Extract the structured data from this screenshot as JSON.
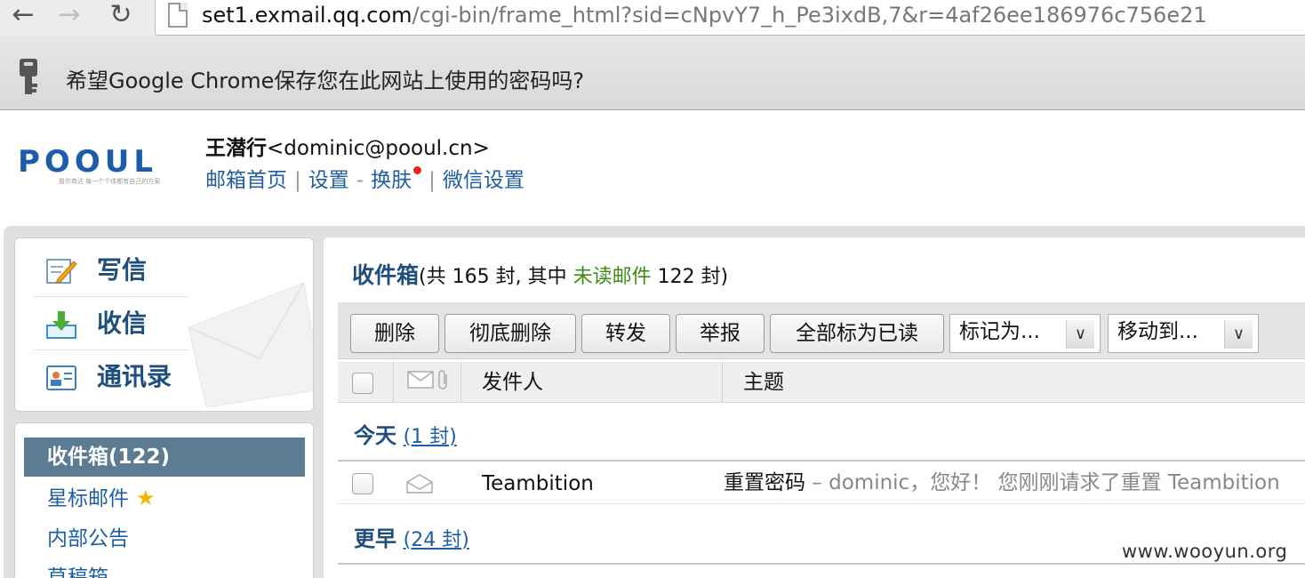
{
  "browser": {
    "url_host": "set1.exmail.qq.com",
    "url_path": "/cgi-bin/frame_html?sid=cNpvY7_h_Pe3ixdB,7&r=4af26ee186976c756e21",
    "password_prompt": "希望Google Chrome保存您在此网站上使用的密码吗?"
  },
  "header": {
    "logo_text": "POOUL",
    "logo_tagline": "普尔商达 每一个个体都有自己的方案",
    "user_name": "王潜行",
    "user_email": "<dominic@pooul.cn>",
    "links": {
      "home": "邮箱首页",
      "settings": "设置",
      "dash": "-",
      "skin": "换肤",
      "wechat": "微信设置",
      "pipe": "|"
    }
  },
  "quick_actions": {
    "compose": "写信",
    "receive": "收信",
    "contacts": "通讯录"
  },
  "folders": {
    "inbox": "收件箱(122)",
    "starred": "星标邮件",
    "announcements": "内部公告",
    "drafts": "草稿箱"
  },
  "mailbox": {
    "title": "收件箱",
    "summary_prefix": "(共 165 封, 其中 ",
    "unread_link": "未读邮件",
    "summary_suffix": " 122 封)"
  },
  "toolbar": {
    "delete": "删除",
    "delete_permanent": "彻底删除",
    "forward": "转发",
    "report": "举报",
    "mark_all_read": "全部标为已读",
    "mark_as": "标记为...",
    "move_to": "移动到..."
  },
  "columns": {
    "sender": "发件人",
    "subject": "主题"
  },
  "groups": {
    "today": {
      "name": "今天",
      "count": "(1 封)"
    },
    "earlier": {
      "name": "更早",
      "count": "(24 封)"
    }
  },
  "rows": [
    {
      "sender": "Teambition",
      "subject": "重置密码",
      "snippet": " – dominic，您好！ 您刚刚请求了重置 Teambition"
    }
  ],
  "watermark": "www.wooyun.org",
  "colors": {
    "link": "#1d5fa7",
    "folder_active": "#5b7c92",
    "unread": "#3d8c17",
    "skin_dot": "#e0281c"
  }
}
